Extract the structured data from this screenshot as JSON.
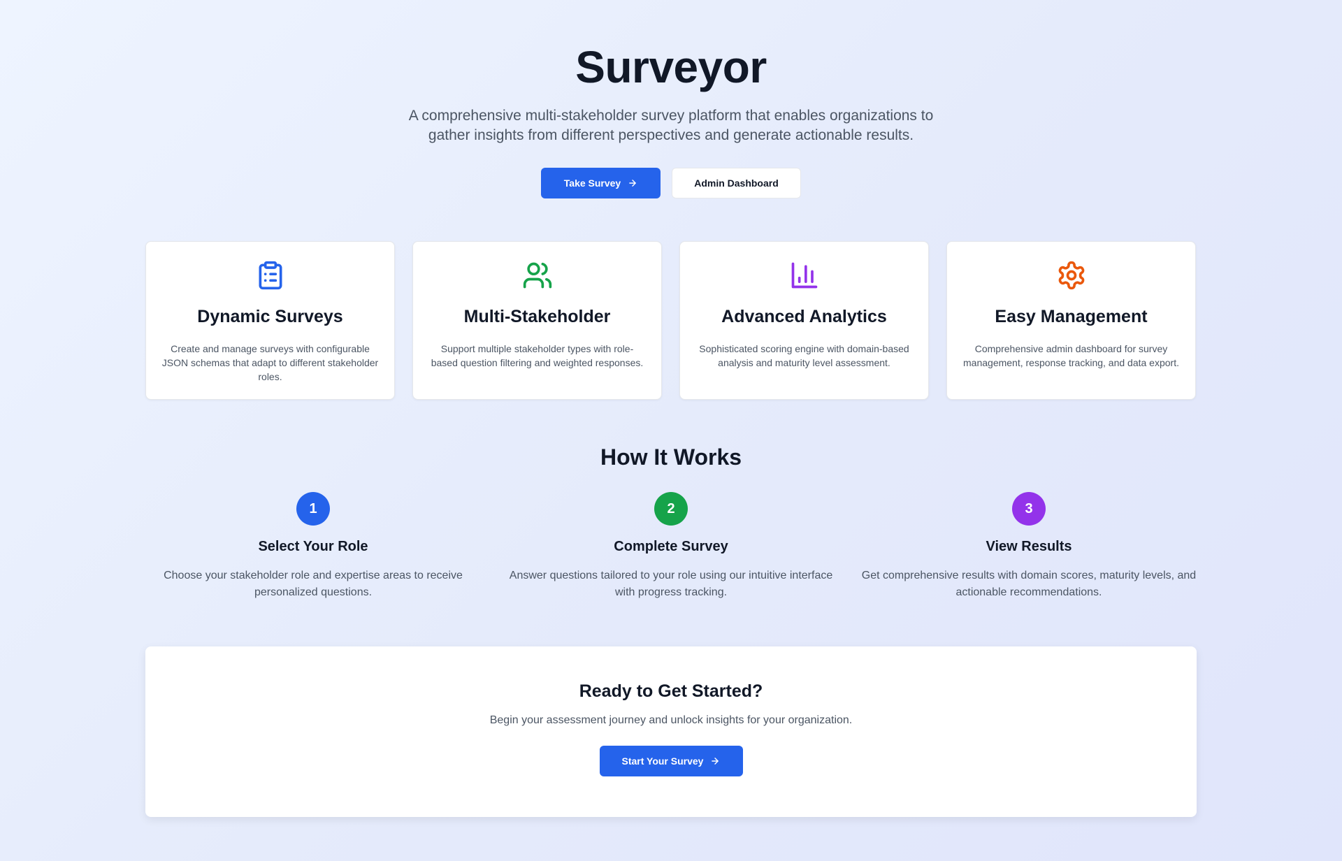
{
  "hero": {
    "title": "Surveyor",
    "subtitle": "A comprehensive multi-stakeholder survey platform that enables organizations to gather insights from different perspectives and generate actionable results.",
    "take_survey_label": "Take Survey",
    "admin_dashboard_label": "Admin Dashboard"
  },
  "features": [
    {
      "icon": "clipboard-list-icon",
      "color": "#2563eb",
      "title": "Dynamic Surveys",
      "description": "Create and manage surveys with configurable JSON schemas that adapt to different stakeholder roles."
    },
    {
      "icon": "users-icon",
      "color": "#16a34a",
      "title": "Multi-Stakeholder",
      "description": "Support multiple stakeholder types with role-based question filtering and weighted responses."
    },
    {
      "icon": "bar-chart-icon",
      "color": "#9333ea",
      "title": "Advanced Analytics",
      "description": "Sophisticated scoring engine with domain-based analysis and maturity level assessment."
    },
    {
      "icon": "settings-gear-icon",
      "color": "#ea580c",
      "title": "Easy Management",
      "description": "Comprehensive admin dashboard for survey management, response tracking, and data export."
    }
  ],
  "how_it_works": {
    "title": "How It Works",
    "steps": [
      {
        "number": "1",
        "color": "#2563eb",
        "title": "Select Your Role",
        "description": "Choose your stakeholder role and expertise areas to receive personalized questions."
      },
      {
        "number": "2",
        "color": "#16a34a",
        "title": "Complete Survey",
        "description": "Answer questions tailored to your role using our intuitive interface with progress tracking."
      },
      {
        "number": "3",
        "color": "#9333ea",
        "title": "View Results",
        "description": "Get comprehensive results with domain scores, maturity levels, and actionable recommendations."
      }
    ]
  },
  "cta": {
    "title": "Ready to Get Started?",
    "description": "Begin your assessment journey and unlock insights for your organization.",
    "button_label": "Start Your Survey"
  },
  "colors": {
    "primary": "#2563eb",
    "heading": "#111827",
    "body_text": "#4b5563"
  }
}
